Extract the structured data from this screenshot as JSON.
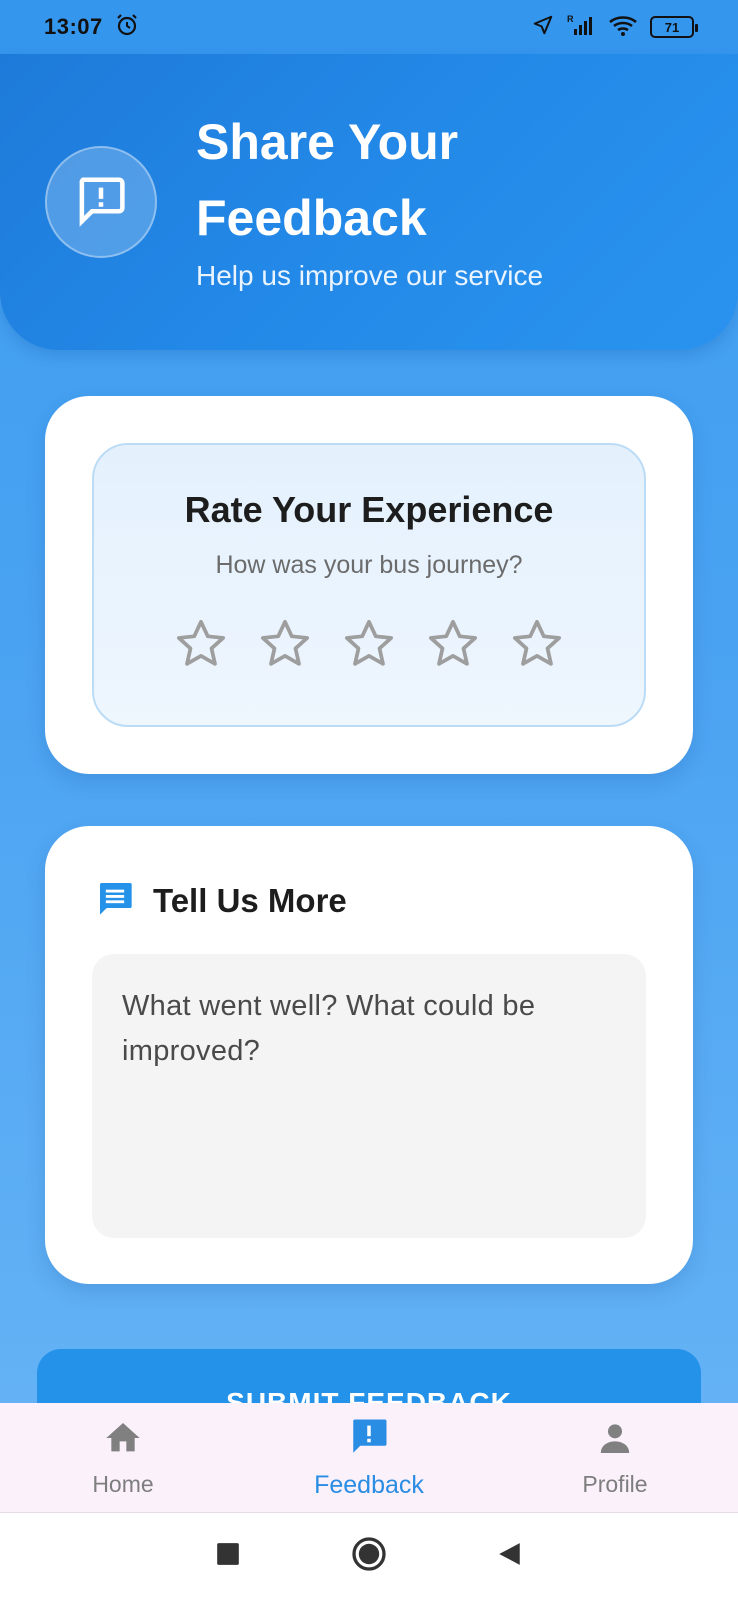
{
  "status_bar": {
    "time": "13:07",
    "battery": "71",
    "icons": [
      "alarm-icon",
      "location-icon",
      "signal-icon",
      "wifi-icon",
      "battery-icon"
    ]
  },
  "header": {
    "title": "Share Your Feedback",
    "subtitle": "Help us improve our service",
    "icon": "feedback-icon"
  },
  "rating": {
    "title": "Rate Your Experience",
    "subtitle": "How was your bus journey?",
    "stars_total": 5,
    "stars_selected": 0
  },
  "more": {
    "title": "Tell Us More",
    "icon": "message-icon",
    "placeholder": "What went well? What could be improved?"
  },
  "submit": {
    "label": "SUBMIT FEEDBACK"
  },
  "nav": {
    "items": [
      {
        "label": "Home",
        "icon": "home-icon",
        "active": false
      },
      {
        "label": "Feedback",
        "icon": "feedback-icon",
        "active": true
      },
      {
        "label": "Profile",
        "icon": "person-icon",
        "active": false
      }
    ]
  },
  "system_nav": [
    "recents-button",
    "home-button",
    "back-button"
  ],
  "colors": {
    "primary": "#2592EA",
    "header": "#1E7AD9",
    "star_outline": "#9E9E9E",
    "nav_active": "#2A8DE4"
  }
}
